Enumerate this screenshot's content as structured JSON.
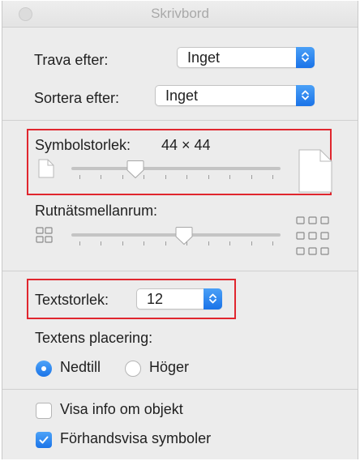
{
  "window": {
    "title": "Skrivbord"
  },
  "stack_by": {
    "label": "Trava efter:",
    "value": "Inget"
  },
  "sort_by": {
    "label": "Sortera efter:",
    "value": "Inget"
  },
  "icon_size": {
    "label": "Symbolstorlek:",
    "value": "44 × 44",
    "level": 0.29
  },
  "grid_spacing": {
    "label": "Rutnätsmellanrum:",
    "level": 0.54
  },
  "text_size": {
    "label": "Textstorlek:",
    "value": "12"
  },
  "label_position": {
    "label": "Textens placering:",
    "options": [
      {
        "label": "Nedtill",
        "selected": true
      },
      {
        "label": "Höger",
        "selected": false
      }
    ]
  },
  "checkboxes": [
    {
      "label": "Visa info om objekt",
      "checked": false
    },
    {
      "label": "Förhandsvisa symboler",
      "checked": true
    }
  ],
  "colors": {
    "accent": "#1b74e8",
    "highlight": "#e0262e",
    "panel": "#ececec"
  },
  "icons": [
    "window-close-button",
    "document-small-icon",
    "document-large-icon",
    "grid-small-icon",
    "grid-large-icon",
    "chevron-updown-icon",
    "checkmark-icon"
  ]
}
